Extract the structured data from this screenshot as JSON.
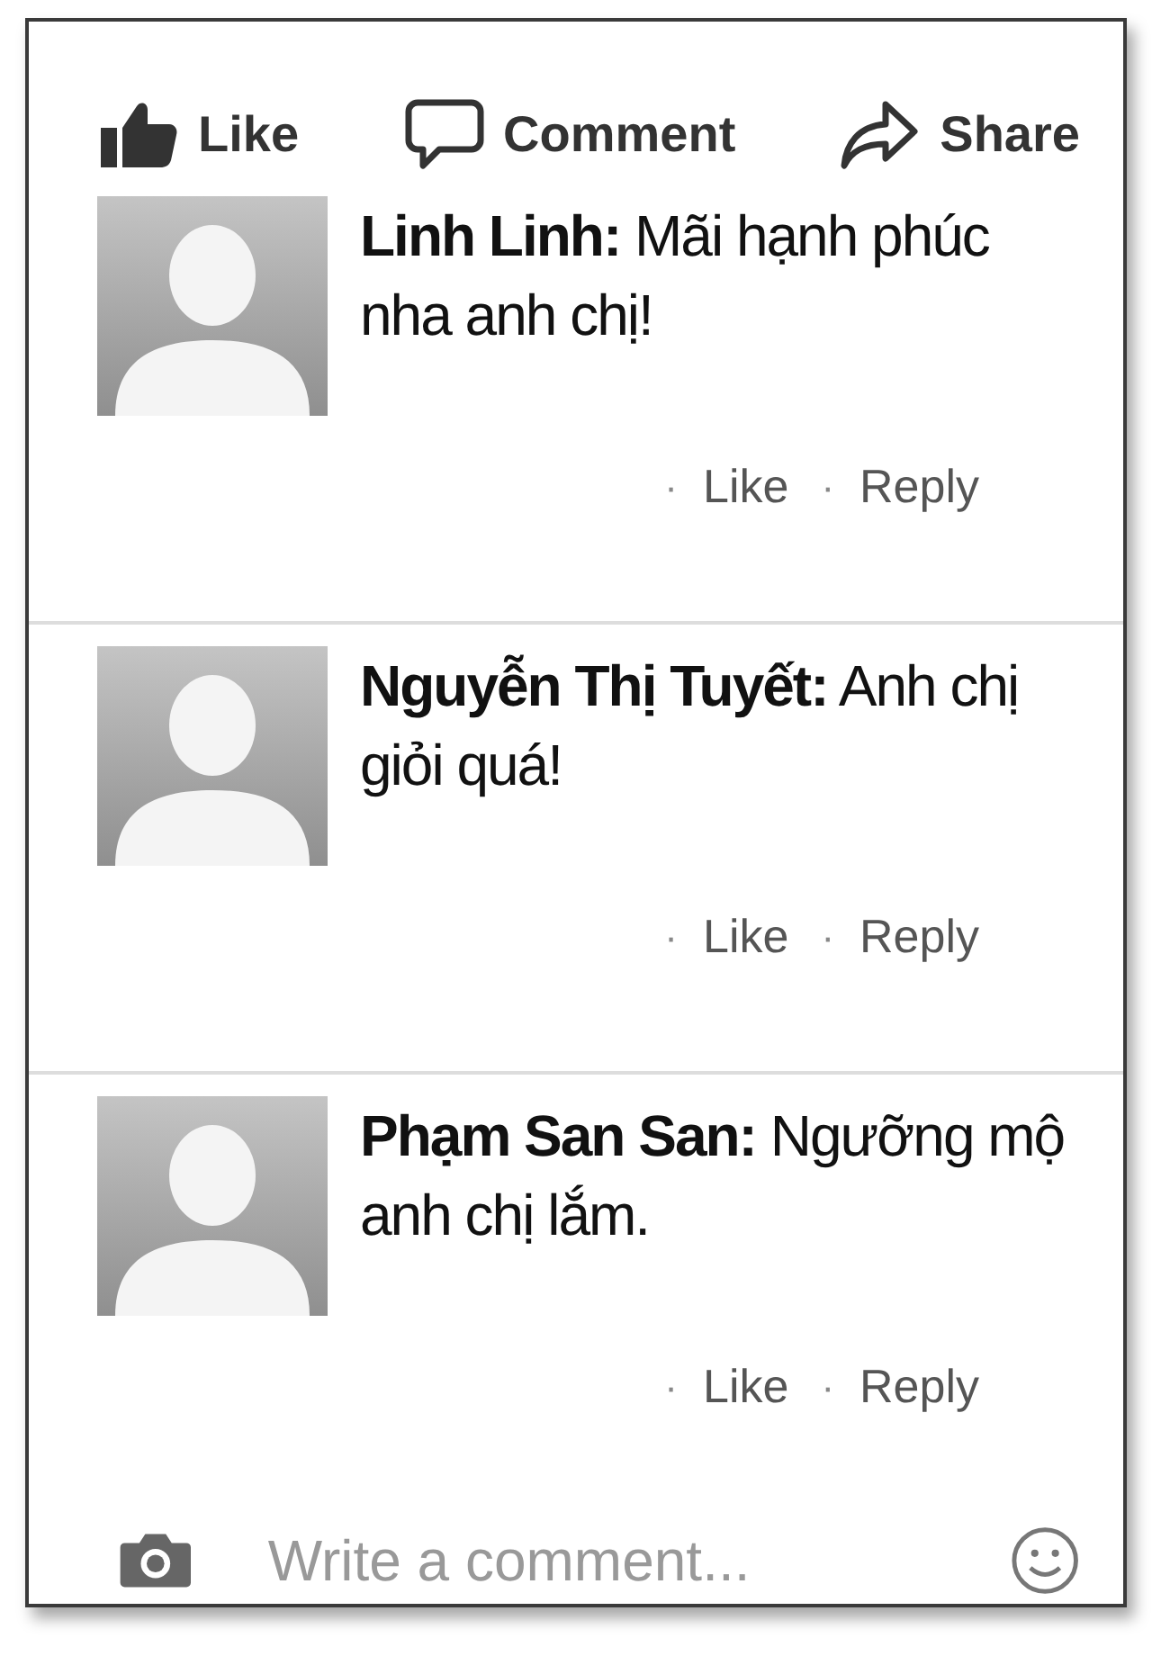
{
  "actions": [
    {
      "kind": "like",
      "label": "Like"
    },
    {
      "kind": "comment",
      "label": "Comment"
    },
    {
      "kind": "share",
      "label": "Share"
    }
  ],
  "comments": [
    {
      "text": "**Linh Linh:** Mãi hạnh phúc nha anh chị!",
      "links": [
        {
          "dot": "·",
          "label": "Like"
        },
        {
          "dot": "·",
          "label": "Reply"
        }
      ]
    },
    {
      "text": "**Nguyễn Thị Tuyết:** Anh chị giỏi quá!",
      "links": [
        {
          "dot": "·",
          "label": "Like"
        },
        {
          "dot": "·",
          "label": "Reply"
        }
      ]
    },
    {
      "text": "**Phạm San San:** Ngưỡng mộ anh chị lắm.",
      "links": [
        {
          "dot": "·",
          "label": "Like"
        },
        {
          "dot": "·",
          "label": "Reply"
        }
      ]
    }
  ],
  "composer": {
    "placeholder": "Write a comment..."
  }
}
